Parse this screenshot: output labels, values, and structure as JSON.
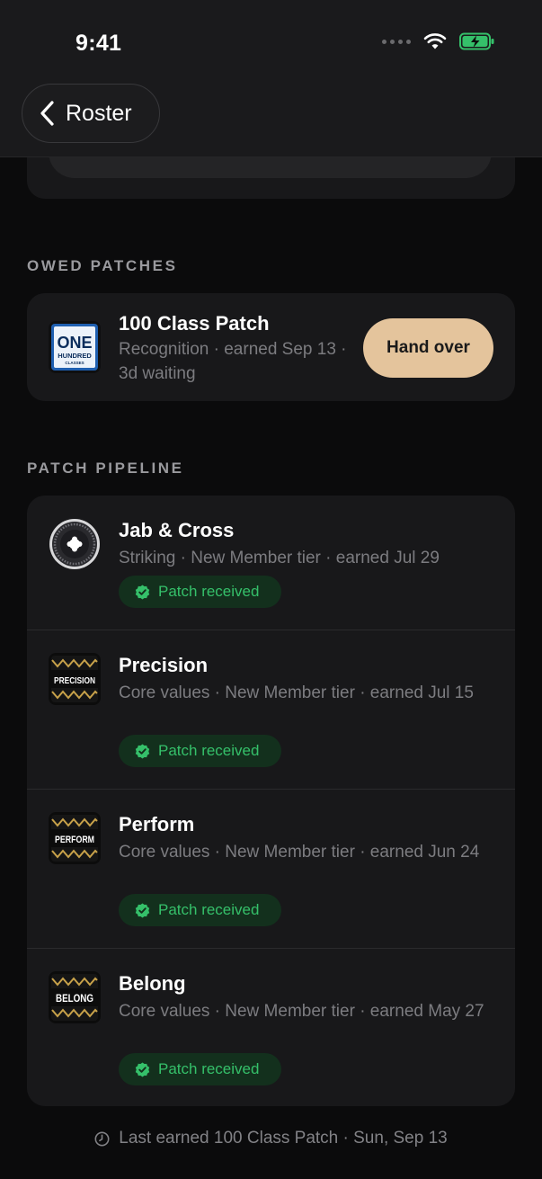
{
  "status_bar": {
    "time": "9:41"
  },
  "nav": {
    "back_label": "Roster"
  },
  "owed_section": {
    "title": "OWED PATCHES",
    "items": [
      {
        "title": "100 Class Patch",
        "meta": "Recognition · earned Sep 13 · 3d waiting",
        "action_label": "Hand over",
        "icon": "one-hundred-classes-patch-icon",
        "icon_text": [
          "ONE",
          "HUNDRED",
          "CLASSES"
        ]
      }
    ]
  },
  "pipeline_section": {
    "title": "PATCH PIPELINE",
    "items": [
      {
        "title": "Jab & Cross",
        "meta": "Striking · New Member tier · earned Jul 29",
        "status": "Patch received",
        "icon": "jab-cross-patch-icon"
      },
      {
        "title": "Precision",
        "meta": "Core values · New Member tier · earned Jul 15",
        "status": "Patch received",
        "icon": "precision-patch-icon",
        "icon_text": "PRECISION"
      },
      {
        "title": "Perform",
        "meta": "Core values · New Member tier · earned Jun 24",
        "status": "Patch received",
        "icon": "perform-patch-icon",
        "icon_text": "PERFORM"
      },
      {
        "title": "Belong",
        "meta": "Core values · New Member tier · earned May 27",
        "status": "Patch received",
        "icon": "belong-patch-icon",
        "icon_text": "BELONG"
      }
    ]
  },
  "footer": {
    "text": "Last earned 100 Class Patch · Sun, Sep 13"
  },
  "colors": {
    "background": "#0b0b0c",
    "card": "#18181a",
    "accent_button": "#e4c49c",
    "success": "#35c06a",
    "success_bg": "#13301d"
  }
}
